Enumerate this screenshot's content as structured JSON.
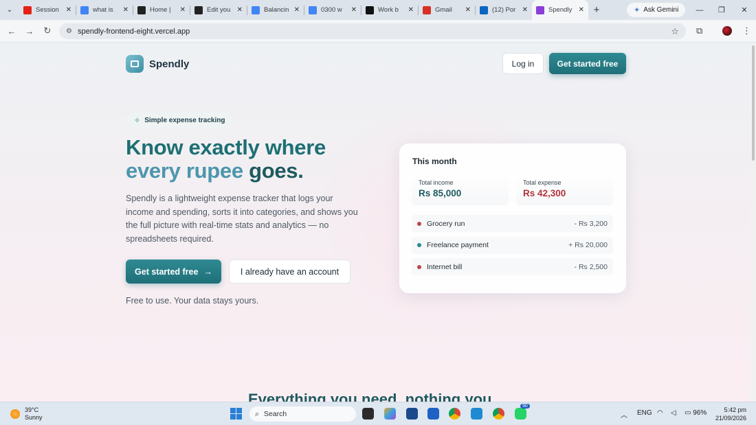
{
  "browser": {
    "tabs": [
      {
        "title": "Session",
        "icon": "youtube-icon",
        "color": "#e62117"
      },
      {
        "title": "what is",
        "icon": "google-icon",
        "color": "#4285f4"
      },
      {
        "title": "Home |",
        "icon": "wix-icon",
        "color": "#222222"
      },
      {
        "title": "Edit you",
        "icon": "wix-icon",
        "color": "#222222"
      },
      {
        "title": "Balancin",
        "icon": "google-icon",
        "color": "#4285f4"
      },
      {
        "title": "0300 w",
        "icon": "google-icon",
        "color": "#4285f4"
      },
      {
        "title": "Work b",
        "icon": "notion-icon",
        "color": "#111111"
      },
      {
        "title": "Gmail",
        "icon": "gmail-icon",
        "color": "#d93025"
      },
      {
        "title": "(12) Por",
        "icon": "linkedin-icon",
        "color": "#0a66c2"
      },
      {
        "title": "Spendly",
        "icon": "spendly-bolt-icon",
        "color": "#8b3fd9",
        "active": true
      }
    ],
    "gemini_label": "Ask Gemini",
    "url": "spendly-frontend-eight.vercel.app"
  },
  "nav": {
    "brand": "Spendly",
    "login": "Log in",
    "get_started": "Get started free"
  },
  "hero": {
    "pill": "Simple expense tracking",
    "title_line1": "Know exactly where",
    "title_accent": "every rupee",
    "title_end": " goes.",
    "description": "Spendly is a lightweight expense tracker that logs your income and spending, sorts it into categories, and shows you the full picture with real-time stats and analytics — no spreadsheets required.",
    "cta_primary": "Get started free",
    "cta_primary_arrow": "→",
    "cta_secondary": "I already have an account",
    "note": "Free to use. Your data stays yours."
  },
  "summary_card": {
    "heading": "This month",
    "income_label": "Total income",
    "income_value": "Rs 85,000",
    "expense_label": "Total expense",
    "expense_value": "Rs 42,300",
    "transactions": [
      {
        "label": "Grocery run",
        "amount": "- Rs 3,200",
        "color": "#c0444c"
      },
      {
        "label": "Freelance payment",
        "amount": "+ Rs 20,000",
        "color": "#2a8a93"
      },
      {
        "label": "Internet bill",
        "amount": "- Rs 2,500",
        "color": "#c0444c"
      }
    ]
  },
  "next_section": {
    "heading": "Everything you need, nothing you"
  },
  "taskbar": {
    "temp": "39°C",
    "condition": "Sunny",
    "search": "Search",
    "whatsapp_badge": "90",
    "lang": "ENG",
    "battery": "96%",
    "time": "5:42 pm",
    "date": "21/09/2026"
  }
}
